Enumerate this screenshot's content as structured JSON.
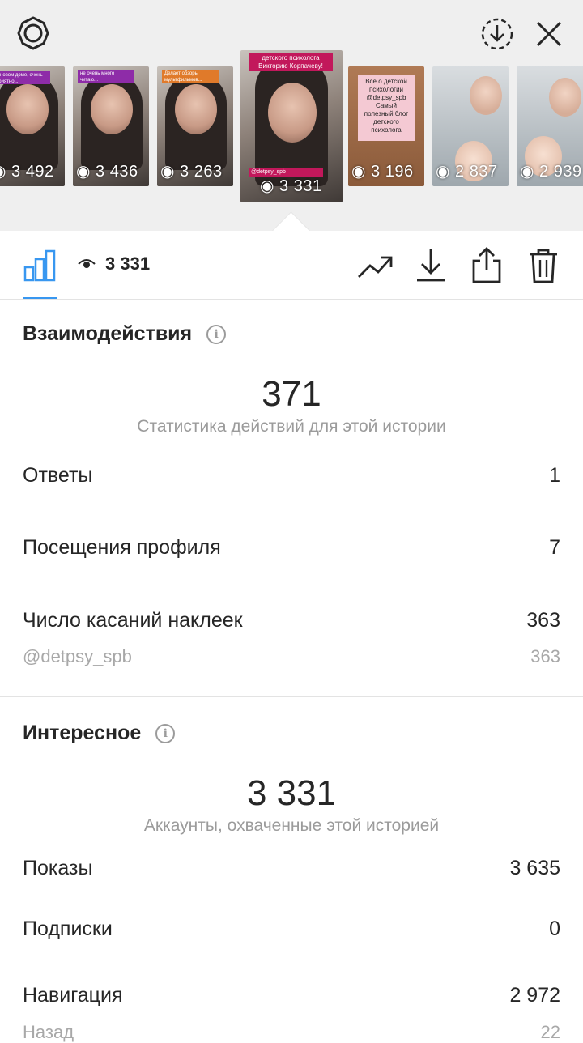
{
  "thumbnails": [
    {
      "views": "3 492",
      "tag": "...новом доме, очень приятно..."
    },
    {
      "views": "3 436",
      "tag": "не очень много читаю..."
    },
    {
      "views": "3 263",
      "tag": "Делает обзоры мультфильмов..."
    },
    {
      "views": "3 331",
      "tag": "детского психолога Викторию Корпачеву!",
      "handle": "@detpsy_spb"
    },
    {
      "views": "3 196",
      "card": "Всё о детской психологии @detpsy_spb Самый полезный блог детского психолога"
    },
    {
      "views": "2 837",
      "tag": ""
    },
    {
      "views": "2 939",
      "tag": ""
    }
  ],
  "toolbar": {
    "reach_count": "3 331"
  },
  "interactions": {
    "title": "Взаимодействия",
    "total": "371",
    "subtitle": "Статистика действий для этой истории",
    "rows": [
      {
        "label": "Ответы",
        "value": "1"
      },
      {
        "label": "Посещения профиля",
        "value": "7"
      },
      {
        "label": "Число касаний наклеек",
        "value": "363"
      }
    ],
    "sticker": {
      "label": "@detpsy_spb",
      "value": "363"
    }
  },
  "discovery": {
    "title": "Интересное",
    "total": "3 331",
    "subtitle": "Аккаунты, охваченные этой историей",
    "rows": [
      {
        "label": "Показы",
        "value": "3 635"
      },
      {
        "label": "Подписки",
        "value": "0"
      },
      {
        "label": "Навигация",
        "value": "2 972"
      }
    ],
    "sub_row": {
      "label": "Назад",
      "value": "22"
    }
  },
  "colors": {
    "accent": "#3897f0",
    "muted": "#9b9b9b"
  },
  "icons": [
    "settings-icon",
    "download-circle-icon",
    "close-icon",
    "bar-chart-icon",
    "eye-icon",
    "trending-icon",
    "download-icon",
    "share-icon",
    "trash-icon",
    "info-icon"
  ]
}
